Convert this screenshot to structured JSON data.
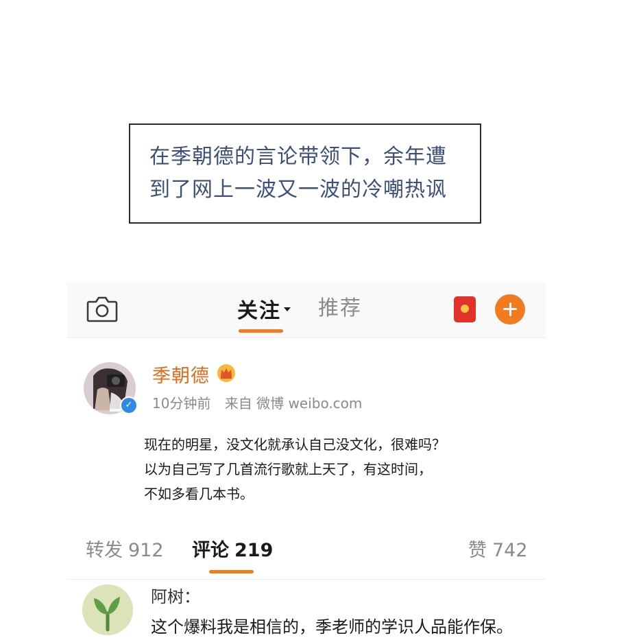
{
  "caption": {
    "lines": [
      "在季朝德的言论带领下，余年遭",
      "到了网上一波又一波的冷嘲热讽"
    ]
  },
  "topbar": {
    "camera_icon": "camera-icon",
    "tab_follow": "关注",
    "tab_recommend": "推荐",
    "redpacket_icon": "red-packet-icon",
    "plus_icon": "plus-icon",
    "accent_color": "#f07c1f"
  },
  "post": {
    "username": "季朝德",
    "username_color": "#e26a19",
    "badge_icon": "crown-icon",
    "verified_icon": "verified-icon",
    "time": "10分钟前",
    "source": "来自 微博 weibo.com",
    "body": [
      "现在的明星，没文化就承认自己没文化，很难吗？",
      "以为自己写了几首流行歌就上天了，有这时间，",
      "不如多看几本书。"
    ]
  },
  "stats": {
    "repost_label": "转发",
    "repost_count": "912",
    "comment_label": "评论",
    "comment_count": "219",
    "like_label": "赞",
    "like_count": "742"
  },
  "comment": {
    "author": "阿树：",
    "text": "这个爆料我是相信的，季老师的学识人品能作保。",
    "avatar_icon": "sprout-icon"
  }
}
